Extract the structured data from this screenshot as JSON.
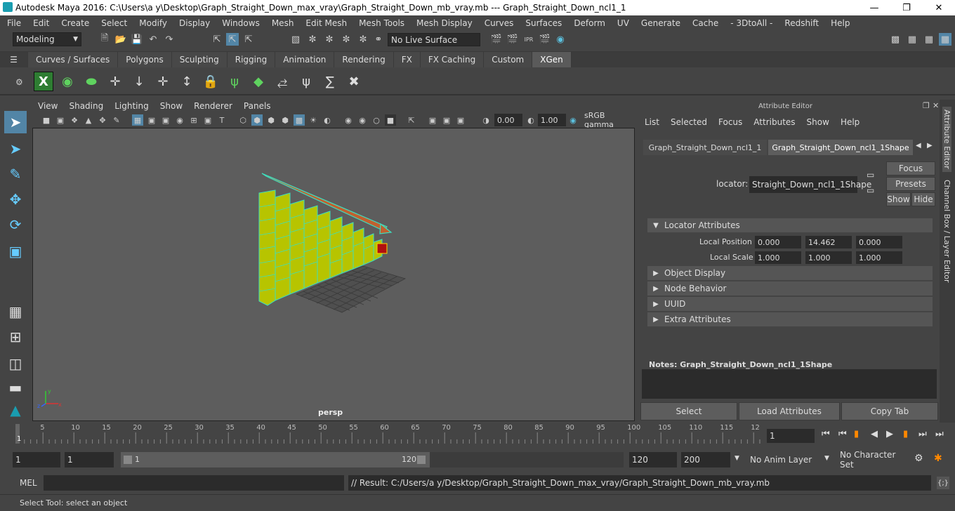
{
  "window": {
    "title": "Autodesk Maya 2016: C:\\Users\\a y\\Desktop\\Graph_Straight_Down_max_vray\\Graph_Straight_Down_mb_vray.mb   ---   Graph_Straight_Down_ncl1_1"
  },
  "menubar": [
    "File",
    "Edit",
    "Create",
    "Select",
    "Modify",
    "Display",
    "Windows",
    "Mesh",
    "Edit Mesh",
    "Mesh Tools",
    "Mesh Display",
    "Curves",
    "Surfaces",
    "Deform",
    "UV",
    "Generate",
    "Cache",
    "- 3DtoAll -",
    "Redshift",
    "Help"
  ],
  "status": {
    "mode": "Modeling",
    "live_surface": "No Live Surface"
  },
  "shelf_tabs": [
    "Curves / Surfaces",
    "Polygons",
    "Sculpting",
    "Rigging",
    "Animation",
    "Rendering",
    "FX",
    "FX Caching",
    "Custom",
    "XGen"
  ],
  "shelf_active": "XGen",
  "viewport": {
    "menu": [
      "View",
      "Shading",
      "Lighting",
      "Show",
      "Renderer",
      "Panels"
    ],
    "exposure": "0.00",
    "gamma": "1.00",
    "color_space": "sRGB gamma",
    "camera_label": "persp"
  },
  "attribute_editor": {
    "title": "Attribute Editor",
    "menu": [
      "List",
      "Selected",
      "Focus",
      "Attributes",
      "Show",
      "Help"
    ],
    "tabs": [
      "Graph_Straight_Down_ncl1_1",
      "Graph_Straight_Down_ncl1_1Shape"
    ],
    "locator_label": "locator:",
    "locator_value": "Straight_Down_ncl1_1Shape",
    "buttons": {
      "focus": "Focus",
      "presets": "Presets",
      "show": "Show",
      "hide": "Hide"
    },
    "locator_section": "Locator Attributes",
    "local_position_label": "Local Position",
    "local_position": [
      "0.000",
      "14.462",
      "0.000"
    ],
    "local_scale_label": "Local Scale",
    "local_scale": [
      "1.000",
      "1.000",
      "1.000"
    ],
    "sections": [
      "Object Display",
      "Node Behavior",
      "UUID",
      "Extra Attributes"
    ],
    "notes": "Notes:  Graph_Straight_Down_ncl1_1Shape",
    "bottom_buttons": [
      "Select",
      "Load Attributes",
      "Copy Tab"
    ]
  },
  "side_tabs": [
    "Attribute Editor",
    "Channel Box / Layer Editor"
  ],
  "timeline": {
    "ticks": [
      "5",
      "10",
      "15",
      "20",
      "25",
      "30",
      "35",
      "40",
      "45",
      "50",
      "55",
      "60",
      "65",
      "70",
      "75",
      "80",
      "85",
      "90",
      "95",
      "100",
      "105",
      "110",
      "115",
      "12"
    ],
    "start_marker": "1",
    "current_frame": "1"
  },
  "range": {
    "start": "1",
    "playback_start": "1",
    "slider_start": "1",
    "slider_end": "120",
    "playback_end": "120",
    "end": "200",
    "anim_layer": "No Anim Layer",
    "char_set": "No Character Set"
  },
  "mel": {
    "label": "MEL",
    "result": "// Result: C:/Users/a y/Desktop/Graph_Straight_Down_max_vray/Graph_Straight_Down_mb_vray.mb"
  },
  "help_line": "Select Tool: select an object"
}
